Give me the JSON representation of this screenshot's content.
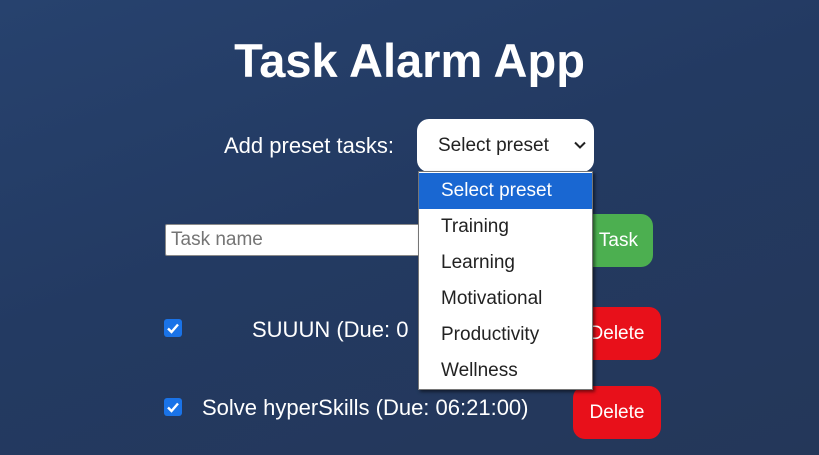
{
  "app": {
    "title": "Task Alarm App"
  },
  "preset": {
    "label": "Add preset tasks:",
    "selected": "Select preset",
    "options": [
      "Select preset",
      "Training",
      "Learning",
      "Motivational",
      "Productivity",
      "Wellness"
    ],
    "dropdown_open": true
  },
  "task_form": {
    "input_placeholder": "Task name",
    "add_button_label": "Task"
  },
  "tasks": [
    {
      "text": "SUUUN (Due: 0",
      "checked": true,
      "delete_label": "Delete"
    },
    {
      "text": "Solve hyperSkills (Due: 06:21:00)",
      "checked": true,
      "delete_label": "Delete"
    }
  ],
  "colors": {
    "background": "#25406a",
    "add_button": "#4caf50",
    "delete_button": "#e8101a",
    "checkbox": "#1a73e8",
    "option_highlight": "#1967d2"
  },
  "icons": {
    "select_arrow": "chevron-down-icon",
    "checkbox_mark": "checkmark-icon"
  }
}
